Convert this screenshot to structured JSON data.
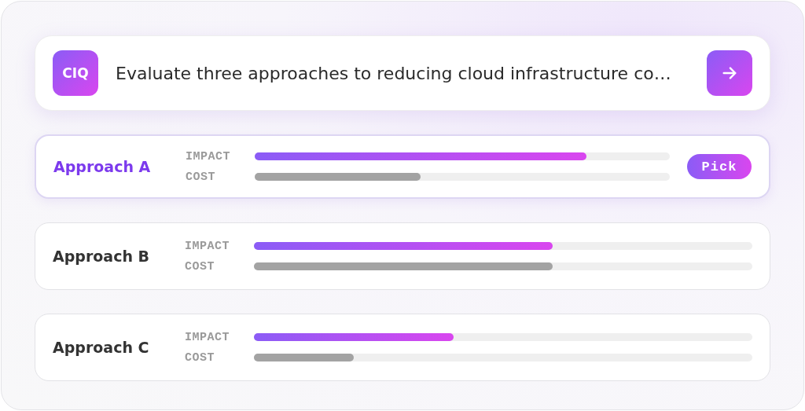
{
  "query": {
    "logo": "CIQ",
    "text": "Evaluate three approaches to reducing cloud infrastructure co…"
  },
  "approaches": [
    {
      "name": "Approach A",
      "selected": true,
      "action": "Pick",
      "metrics": [
        {
          "label": "IMPACT",
          "kind": "impact",
          "level": 0.8
        },
        {
          "label": "COST",
          "kind": "cost",
          "level": 0.4
        }
      ]
    },
    {
      "name": "Approach B",
      "selected": false,
      "metrics": [
        {
          "label": "IMPACT",
          "kind": "impact",
          "level": 0.6
        },
        {
          "label": "COST",
          "kind": "cost",
          "level": 0.6
        }
      ]
    },
    {
      "name": "Approach C",
      "selected": false,
      "metrics": [
        {
          "label": "IMPACT",
          "kind": "impact",
          "level": 0.4
        },
        {
          "label": "COST",
          "kind": "cost",
          "level": 0.2
        }
      ]
    }
  ]
}
